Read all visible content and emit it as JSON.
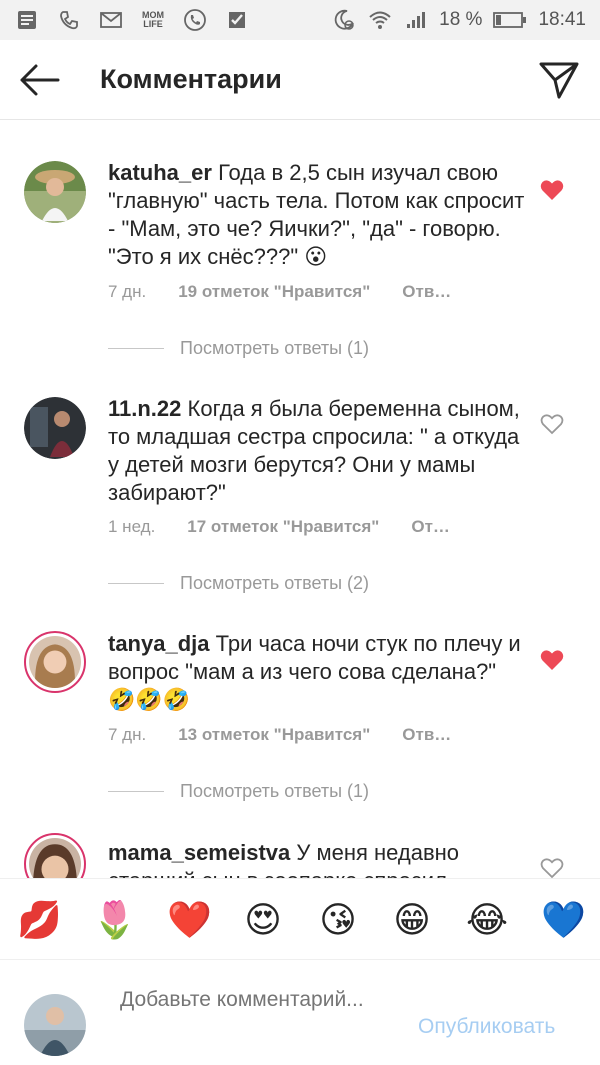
{
  "status_bar": {
    "icons_left": [
      "message-icon",
      "phone-icon",
      "mail-icon",
      "mom-life-icon",
      "viber-icon",
      "task-icon"
    ],
    "mom_life": "MOM LIFE",
    "battery_percent": "18 %",
    "time": "18:41",
    "icons_right": [
      "alarm-icon",
      "wifi-icon",
      "signal-icon",
      "battery-icon"
    ]
  },
  "header": {
    "title": "Комментарии",
    "back_icon": "arrow-left-icon",
    "send_icon": "paper-plane-icon"
  },
  "comments": [
    {
      "username": "katuha_er",
      "text": "Года в 2,5 сын изучал свою \"главную\" часть тела. Потом как спросит - \"Мам, это че? Яички?\", \"да\" - говорю. \"Это я их снёс???\"",
      "emoji": "😮",
      "time": "7 дн.",
      "likes": "19 отметок \"Нравится\"",
      "reply": "Отв…",
      "liked": true,
      "view_replies": "Посмотреть ответы (1)"
    },
    {
      "username": "11.n.22",
      "text": "Когда я была беременна сыном, то младшая сестра спросила: \" а откуда у детей мозги берутся? Они у мамы забирают?\"",
      "emoji": "",
      "time": "1 нед.",
      "likes": "17 отметок \"Нравится\"",
      "reply": "От…",
      "liked": false,
      "view_replies": "Посмотреть ответы (2)"
    },
    {
      "username": "tanya_dja",
      "text": "Три часа ночи стук по плечу и вопрос \"мам а из чего сова сделана?\"",
      "emoji": "🤣🤣🤣",
      "time": "7 дн.",
      "likes": "13 отметок \"Нравится\"",
      "reply": "Отв…",
      "liked": true,
      "view_replies": "Посмотреть ответы (1)"
    },
    {
      "username": "mama_semeistva",
      "text": "У меня недавно старший сын в зоопарке спросил",
      "emoji": "",
      "liked": false
    }
  ],
  "emoji_bar": [
    "💋",
    "🌷",
    "❤️",
    "😍",
    "😘",
    "😁",
    "😂",
    "💙"
  ],
  "composer": {
    "placeholder": "Добавьте комментарий...",
    "publish_label": "Опубликовать"
  },
  "colors": {
    "heart_red": "#ed4956",
    "publish_blue": "#a6cdf2",
    "text": "#262626",
    "muted": "#999999"
  }
}
